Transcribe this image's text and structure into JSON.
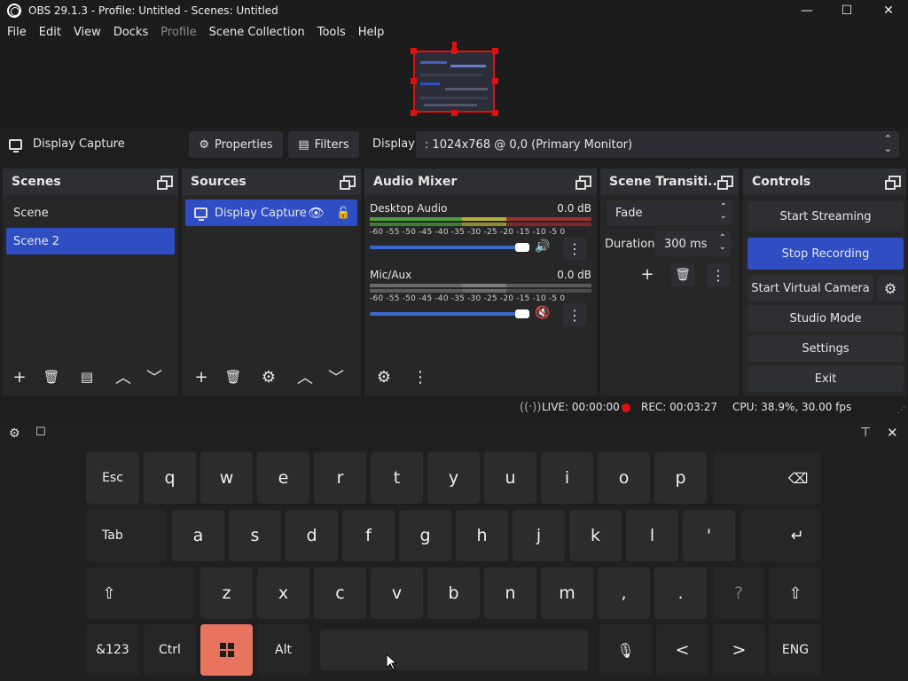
{
  "window": {
    "title": "OBS 29.1.3 - Profile: Untitled - Scenes: Untitled",
    "minimize": "—",
    "maximize": "☐",
    "close": "✕"
  },
  "menu": {
    "items": [
      "File",
      "Edit",
      "View",
      "Docks",
      "Profile",
      "Scene Collection",
      "Tools",
      "Help"
    ]
  },
  "source_toolbar": {
    "source_name": "Display Capture",
    "properties_label": "Properties",
    "filters_label": "Filters",
    "display_label": "Display",
    "display_value": ": 1024x768 @ 0,0 (Primary Monitor)"
  },
  "scenes": {
    "title": "Scenes",
    "items": [
      "Scene",
      "Scene 2"
    ],
    "selected_index": 1
  },
  "sources": {
    "title": "Sources",
    "items": [
      "Display Capture"
    ]
  },
  "audio_mixer": {
    "title": "Audio Mixer",
    "channels": [
      {
        "name": "Desktop Audio",
        "level": "0.0 dB",
        "muted": false,
        "volume": 0.97
      },
      {
        "name": "Mic/Aux",
        "level": "0.0 dB",
        "muted": true,
        "volume": 0.97
      }
    ],
    "ticks": "-60 -55 -50 -45 -40 -35 -30 -25 -20 -15 -10 -5 0"
  },
  "transitions": {
    "title": "Scene Transiti...",
    "type": "Fade",
    "duration_label": "Duration",
    "duration_value": "300 ms"
  },
  "controls": {
    "title": "Controls",
    "start_streaming": "Start Streaming",
    "stop_recording": "Stop Recording",
    "virtual_camera": "Start Virtual Camera",
    "studio_mode": "Studio Mode",
    "settings": "Settings",
    "exit": "Exit"
  },
  "status": {
    "live": "LIVE: 00:00:00",
    "rec": "REC: 00:03:27",
    "cpu": "CPU: 38.9%, 30.00 fps"
  },
  "keyboard": {
    "row1": [
      "Esc",
      "q",
      "w",
      "e",
      "r",
      "t",
      "y",
      "u",
      "i",
      "o",
      "p"
    ],
    "row2": [
      "Tab",
      "a",
      "s",
      "d",
      "f",
      "g",
      "h",
      "j",
      "k",
      "l",
      "'"
    ],
    "row3": [
      "z",
      "x",
      "c",
      "v",
      "b",
      "n",
      "m",
      ",",
      ".",
      "?"
    ],
    "row4_left": [
      "&123",
      "Ctrl"
    ],
    "alt": "Alt",
    "lang": "ENG",
    "left_arrow": "<",
    "right_arrow": ">"
  },
  "colors": {
    "accent": "#2f4ec4",
    "recording_red": "#e01010",
    "windows_key": "#e8735f"
  }
}
